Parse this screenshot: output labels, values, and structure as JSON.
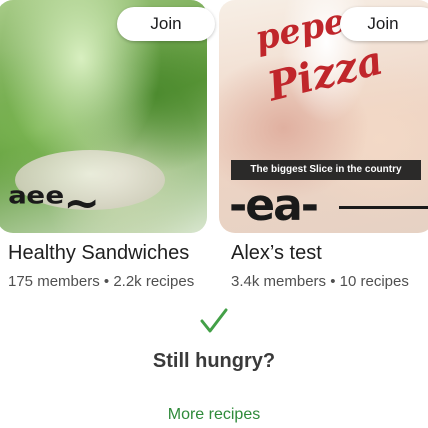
{
  "cards": [
    {
      "title": "Healthy Sandwiches",
      "members": "175 members",
      "separator": "•",
      "recipes": "2.2k recipes",
      "join_label": "Join",
      "image_icon": "sandwich-photo"
    },
    {
      "title": "Alex’s test",
      "members": "3.4k members",
      "separator": "•",
      "recipes": "10 recipes",
      "join_label": "Join",
      "image_icon": "pizza-photo",
      "poster_word_1": "pepe",
      "poster_word_2": "Pizza",
      "banner_text": "The biggest Slice in the country"
    }
  ],
  "end_section": {
    "icon": "checkmark-icon",
    "heading": "Still hungry?",
    "link_label": "More recipes"
  },
  "colors": {
    "accent_green": "#2f8a3a",
    "check_green": "#43a047",
    "text_primary": "#1f1f1f",
    "text_secondary": "#505050"
  }
}
